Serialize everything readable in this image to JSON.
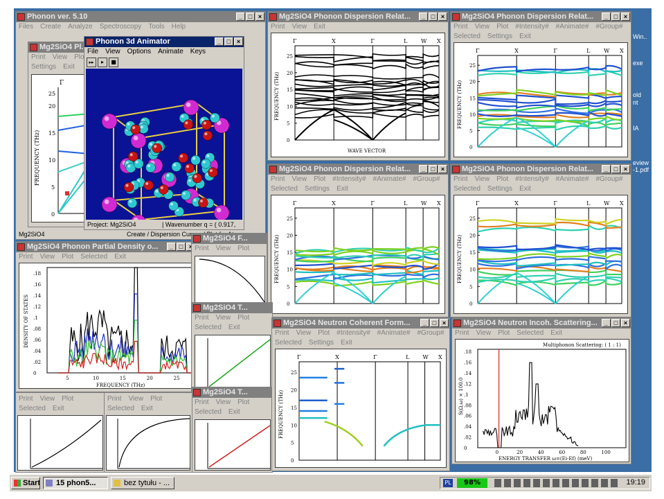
{
  "desktop": {
    "icons": [
      "Win..",
      "exe",
      "old",
      "nt",
      "IA",
      "eview",
      "-1.pdf"
    ]
  },
  "colors": {
    "desktop": "#3a6ea5",
    "title_active": "#0a246a",
    "title_inactive": "#808080",
    "window": "#d4d0c8",
    "animator_bg": "#0a1296",
    "atom_magenta": "#d22ad2",
    "atom_cyan": "#2ec8d2",
    "atom_red": "#c81414",
    "cell_edge": "#e8d040",
    "battery_green": "#18c818"
  },
  "main": {
    "title": "Phonon ver. 5.10",
    "menu": [
      "Files",
      "Create",
      "Analyze",
      "Spectroscopy",
      "Tools",
      "Help"
    ],
    "status_left": "Mg2SiO4",
    "status_right": "Create / Dispersion Curves / Plot for Atoms"
  },
  "small_disp": {
    "title": "Mg2SiO4 Pl...",
    "menu1": [
      "Print",
      "View",
      "Plo"
    ],
    "menu2": [
      "Settings",
      "Exit"
    ],
    "yticks": [
      "0",
      "5",
      "10",
      "15",
      "20",
      "25"
    ],
    "ylabel": "FREQUENCY (THz)",
    "tick_top": "Γ"
  },
  "animator": {
    "title": "Phonon 3d Animator",
    "menu": [
      "File",
      "View",
      "Options",
      "Animate",
      "Keys"
    ],
    "toolbar": [
      "▸▸",
      "▸",
      "■"
    ],
    "status_left": "Project: Mg2SiO4",
    "status_right": "| Wavenumber  q = ( 0.917,"
  },
  "disp1": {
    "title": "Mg2SiO4 Phonon Dispersion Relat...",
    "menu": [
      "Print",
      "View",
      "Exit"
    ],
    "points": [
      "Γ",
      "X",
      "Γ",
      "L",
      "W",
      "X"
    ],
    "yticks": [
      "0",
      "5",
      "10",
      "15",
      "20",
      "25"
    ],
    "ylabel": "FREQUENCY (THz)",
    "xlabel": "WAVE VECTOR"
  },
  "disp2": {
    "title": "Mg2SiO4 Phonon Dispersion Relat...",
    "menu1": [
      "Print",
      "View",
      "Plot",
      "#Intensity#",
      "#Animate#",
      "#Group#"
    ],
    "menu2": [
      "Selected",
      "Settings",
      "Exit"
    ],
    "points": [
      "Γ",
      "X",
      "Γ",
      "L",
      "W",
      "X"
    ],
    "yticks": [
      "0",
      "5",
      "10",
      "15",
      "20",
      "25"
    ],
    "ylabel": "FREQUENCY (THz)"
  },
  "disp3": {
    "title": "Mg2SiO4 Phonon Dispersion Relat...",
    "menu1": [
      "Print",
      "View",
      "Plot",
      "#Intensity#",
      "#Animate#",
      "#Group#"
    ],
    "menu2": [
      "Selected",
      "Settings",
      "Exit"
    ],
    "points": [
      "Γ",
      "X",
      "Γ",
      "L",
      "W",
      "X"
    ],
    "yticks": [
      "0",
      "5",
      "10",
      "15",
      "20",
      "25"
    ],
    "ylabel": "FREQUENCY (THz)"
  },
  "disp4": {
    "title": "Mg2SiO4 Phonon Dispersion Relat...",
    "menu1": [
      "Print",
      "View",
      "Plot",
      "#Intensity#",
      "#Animate#",
      "#Group#"
    ],
    "menu2": [
      "Selected",
      "Settings",
      "Exit"
    ],
    "points": [
      "Γ",
      "X",
      "Γ",
      "L",
      "W",
      "X"
    ],
    "yticks": [
      "0",
      "5",
      "10",
      "15",
      "20",
      "25"
    ],
    "ylabel": "FREQUENCY (THz)"
  },
  "pdos": {
    "title": "Mg2SiO4 Phonon Partial Density o...",
    "menu": [
      "Print",
      "View",
      "Plot",
      "Selected",
      "Exit"
    ],
    "yticks": [
      "0",
      ".02",
      ".04",
      ".06",
      ".08",
      ".1",
      ".12",
      ".14",
      ".16",
      ".18"
    ],
    "xticks": [
      "5",
      "10",
      "15",
      "20",
      "25"
    ],
    "ylabel": "DENSITY OF STATES",
    "xlabel": "FREQUENCY (THz)"
  },
  "small_f": {
    "title": "Mg2SiO4 F...",
    "menu": [
      "Print",
      "View",
      "Plot"
    ]
  },
  "small_t1": {
    "title": "Mg2SiO4 T...",
    "menu1": [
      "Print",
      "View",
      "Plot"
    ],
    "menu2": [
      "Selected",
      "Exit"
    ]
  },
  "small_t2": {
    "title": "Mg2SiO4 T...",
    "menu1": [
      "Print",
      "View",
      "Plot"
    ],
    "menu2": [
      "Selected",
      "Exit"
    ]
  },
  "small_bl": {
    "menu1": [
      "Print",
      "View",
      "Plot"
    ],
    "menu2": [
      "Selected",
      "Exit"
    ]
  },
  "small_bm": {
    "menu1": [
      "Print",
      "View",
      "Plot"
    ],
    "menu2": [
      "Selected",
      "Exit"
    ]
  },
  "neutron_coh": {
    "title": "Mg2SiO4 Neutron Coherent Form...",
    "menu1": [
      "Print",
      "View",
      "Plot",
      "#Intensity#",
      "#Animate#",
      "#Group#"
    ],
    "menu2": [
      "Selected",
      "Settings",
      "Exit"
    ],
    "points": [
      "Γ",
      "X",
      "Γ",
      "L",
      "W",
      "X"
    ],
    "yticks": [
      "0",
      "5",
      "10",
      "15",
      "20",
      "25"
    ],
    "ylabel": "FREQUENCY (THz)"
  },
  "neutron_inc": {
    "title": "Mg2SiO4 Neutron Incoh. Scattering...",
    "menu": [
      "Print",
      "View",
      "Plot",
      "Selected",
      "Exit"
    ],
    "note": "Multiphonon Scattering: ( 1 : 1)",
    "yticks": [
      "0",
      ".02",
      ".04",
      ".06",
      ".08",
      ".1",
      ".12",
      ".14",
      ".16",
      ".18"
    ],
    "xticks": [
      "0",
      "20",
      "40",
      "60",
      "80",
      "100"
    ],
    "ylabel": "S(Ω,ω) × 100.0",
    "xlabel": "ENERGY TRANSFER ω=(Ei-Ef) (meV)"
  },
  "taskbar": {
    "start": "Start",
    "btn1": "15 phon5...",
    "btn2": "bez tytułu - ...",
    "lang": "PL",
    "battery": "98%",
    "time": "19:19"
  }
}
